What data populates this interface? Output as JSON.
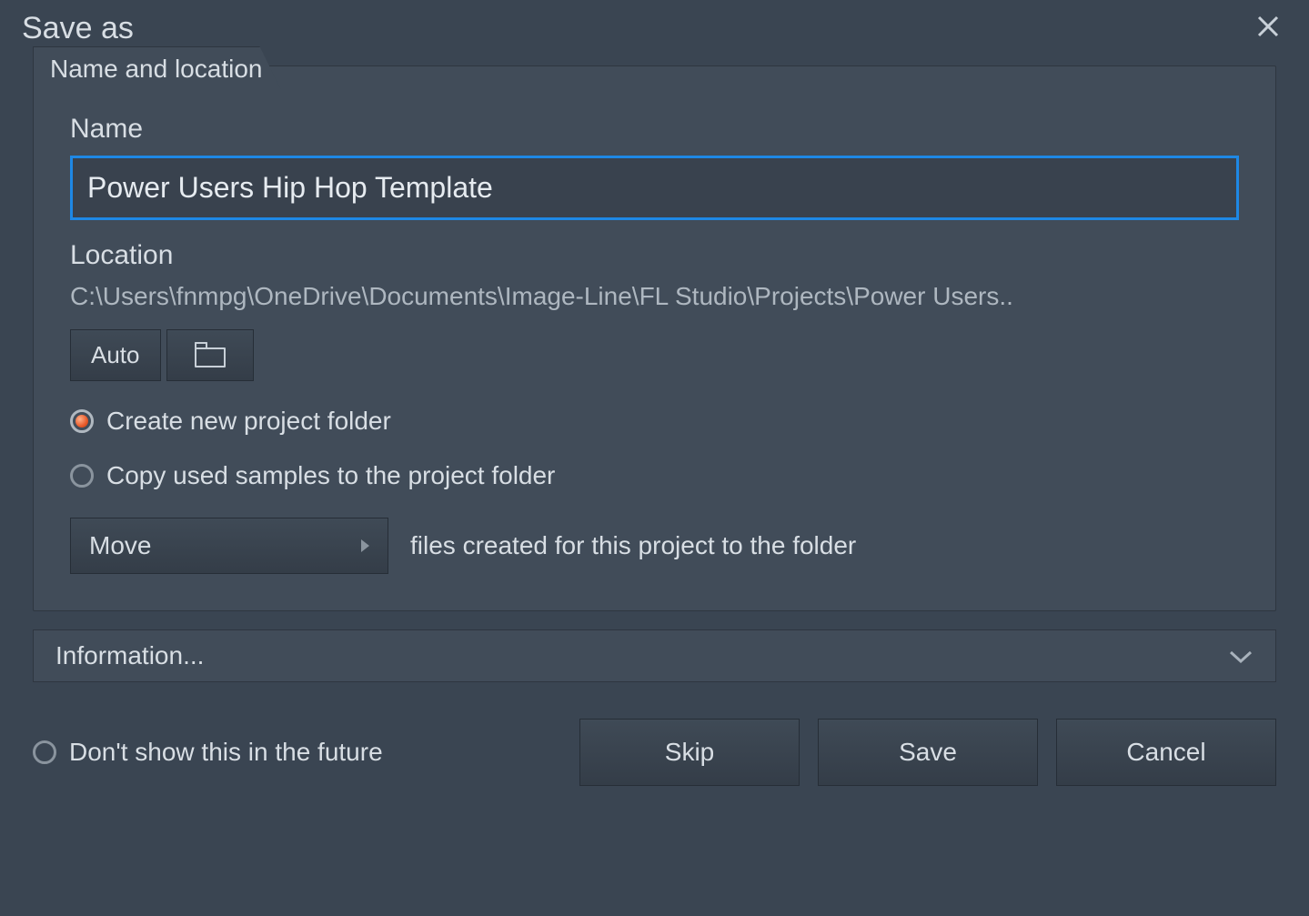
{
  "dialog": {
    "title": "Save as"
  },
  "panel": {
    "tab_label": "Name and location",
    "name_label": "Name",
    "name_value": "Power Users Hip Hop Template",
    "location_label": "Location",
    "location_path": "C:\\Users\\fnmpg\\OneDrive\\Documents\\Image-Line\\FL Studio\\Projects\\Power Users..",
    "auto_label": "Auto",
    "radio_create_label": "Create new project folder",
    "radio_copy_label": "Copy used samples to the project folder",
    "dropdown_value": "Move",
    "dropdown_suffix": "files created for this project to the folder"
  },
  "info": {
    "label": "Information..."
  },
  "footer": {
    "dont_show_label": "Don't show this in the future",
    "skip_label": "Skip",
    "save_label": "Save",
    "cancel_label": "Cancel"
  }
}
